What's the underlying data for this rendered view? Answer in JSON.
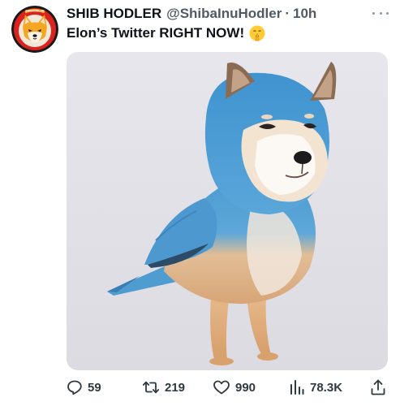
{
  "tweet": {
    "author": {
      "display_name": "SHIB HODLER",
      "handle": "@ShibaInuHodler",
      "separator": "·",
      "time": "10h",
      "avatar_icon": "shiba-inu-logo-icon",
      "avatar_badge_text": "SHIBHODLER"
    },
    "text": "Elon’s Twitter RIGHT NOW!",
    "emoji": "shushing-face-emoji",
    "media": {
      "description_icon": "shiba-bird-image"
    },
    "actions": {
      "reply_count": "59",
      "retweet_count": "219",
      "like_count": "990",
      "views_count": "78.3K"
    }
  },
  "colors": {
    "text_primary": "#0f1419",
    "text_secondary": "#505a64",
    "media_bg": "#e5e4ea",
    "bird_blue": "#4f9fd4",
    "avatar_red": "#c81d1d",
    "avatar_orange": "#f5a623"
  }
}
